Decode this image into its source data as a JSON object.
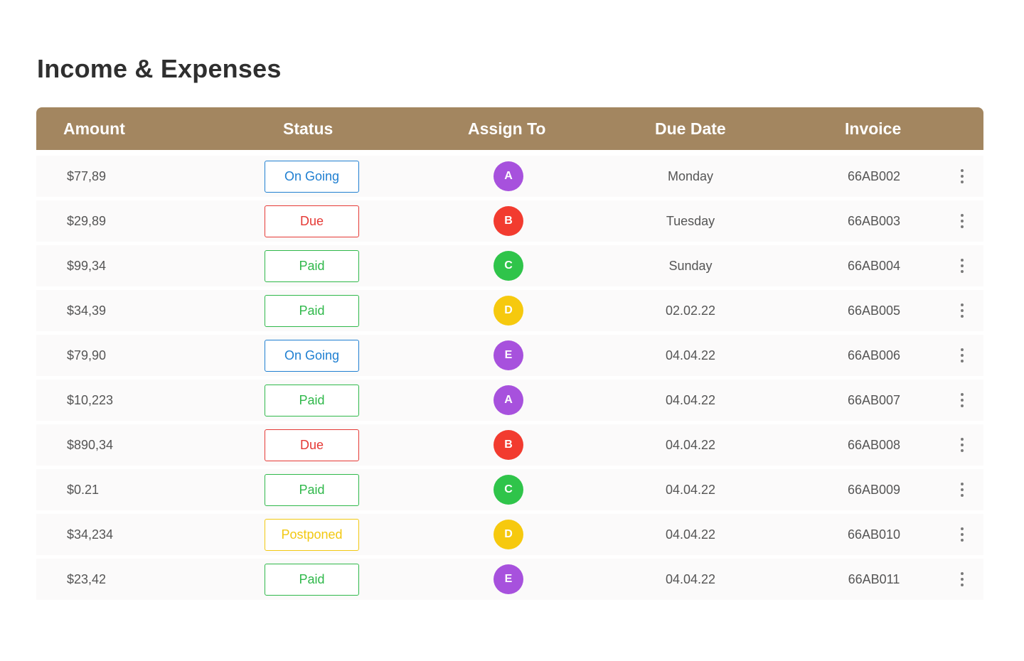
{
  "page": {
    "title": "Income & Expenses"
  },
  "table": {
    "headers": {
      "amount": "Amount",
      "status": "Status",
      "assign_to": "Assign To",
      "due_date": "Due Date",
      "invoice": "Invoice"
    },
    "menu_icon": "kebab-menu-icon",
    "status_colors": {
      "On Going": "#1f7fd1",
      "Due": "#e53935",
      "Paid": "#2fb84a",
      "Postponed": "#f2c811"
    },
    "avatar_colors": {
      "A": "#a751dd",
      "B": "#f23b2f",
      "C": "#2fc44a",
      "D": "#f6c90e",
      "E": "#a751dd"
    },
    "rows": [
      {
        "amount": "$77,89",
        "status": "On Going",
        "assignee": "A",
        "due_date": "Monday",
        "invoice": "66AB002"
      },
      {
        "amount": "$29,89",
        "status": "Due",
        "assignee": "B",
        "due_date": "Tuesday",
        "invoice": "66AB003"
      },
      {
        "amount": "$99,34",
        "status": "Paid",
        "assignee": "C",
        "due_date": "Sunday",
        "invoice": "66AB004"
      },
      {
        "amount": "$34,39",
        "status": "Paid",
        "assignee": "D",
        "due_date": "02.02.22",
        "invoice": "66AB005"
      },
      {
        "amount": "$79,90",
        "status": "On Going",
        "assignee": "E",
        "due_date": "04.04.22",
        "invoice": "66AB006"
      },
      {
        "amount": "$10,223",
        "status": "Paid",
        "assignee": "A",
        "due_date": "04.04.22",
        "invoice": "66AB007"
      },
      {
        "amount": "$890,34",
        "status": "Due",
        "assignee": "B",
        "due_date": "04.04.22",
        "invoice": "66AB008"
      },
      {
        "amount": "$0.21",
        "status": "Paid",
        "assignee": "C",
        "due_date": "04.04.22",
        "invoice": "66AB009"
      },
      {
        "amount": "$34,234",
        "status": "Postponed",
        "assignee": "D",
        "due_date": "04.04.22",
        "invoice": "66AB010"
      },
      {
        "amount": "$23,42",
        "status": "Paid",
        "assignee": "E",
        "due_date": "04.04.22",
        "invoice": "66AB011"
      }
    ]
  }
}
